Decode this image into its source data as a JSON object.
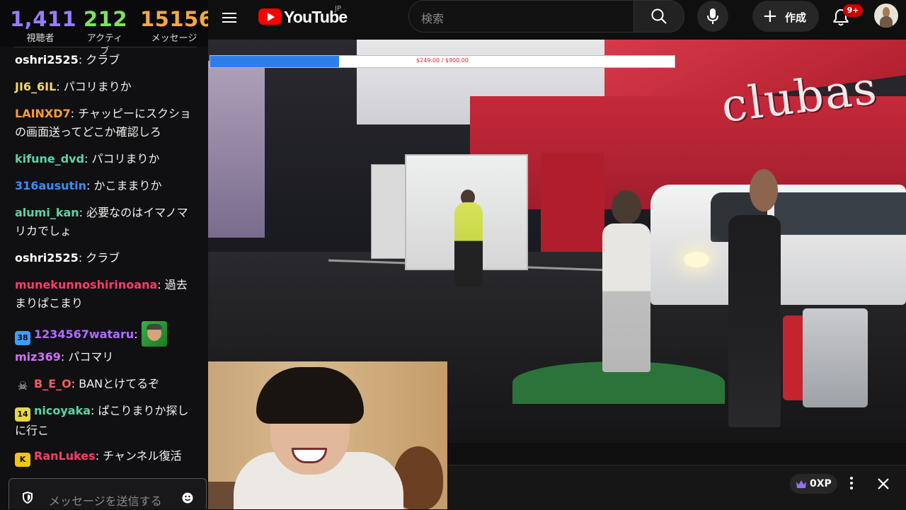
{
  "stats": [
    {
      "value": "1,411",
      "label": "視聴者"
    },
    {
      "value": "212",
      "label": "アクティブ"
    },
    {
      "value": "15156",
      "label": "メッセージ"
    }
  ],
  "chat": {
    "messages": [
      {
        "user": "oshri2525",
        "text": ": クラブ",
        "color": "#ffffff"
      },
      {
        "user": "JI6_6IL",
        "text": ": パコリまりか",
        "color": "#f5d76e"
      },
      {
        "user": "LAINXD7",
        "text": ": チャッピーにスクショの画面送ってどこか確認しろ",
        "color": "#ff9b3b"
      },
      {
        "user": "kifune_dvd",
        "text": ": パコリまりか",
        "color": "#58d6a8"
      },
      {
        "user": "316ausutin",
        "text": ": かこままりか",
        "color": "#3a8dff"
      },
      {
        "user": "alumi_kan",
        "text": ": 必要なのはイマノマリカでしょ",
        "color": "#58d6a8"
      },
      {
        "user": "oshri2525",
        "text": ": クラブ",
        "color": "#ffffff"
      },
      {
        "user": "munekunnoshirinoana",
        "text": ": 過去まりぱこまり",
        "color": "#ff3b6b"
      },
      {
        "user": "1234567wataru",
        "text": ":",
        "color": "#b06cff",
        "badge": "38",
        "badge_color": "#3aa0ff",
        "emote": "face-emote"
      },
      {
        "user": "miz369",
        "text": ": パコマリ",
        "color": "#d66bff"
      },
      {
        "user": "B_E_O",
        "text": ": BANとけてるぞ",
        "color": "#ff5a5a",
        "badge_icon": "skull-icon"
      },
      {
        "user": "nicoyaka",
        "text": ": ぱこりまりか探しに行こ",
        "color": "#58d6a8",
        "badge": "14",
        "badge_color": "#e6d64a"
      },
      {
        "user": "RanLukes",
        "text": ": チャンネル復活",
        "color": "#ff3b6b",
        "badge_icon": "k-icon"
      }
    ],
    "input_placeholder": "メッセージを送信する"
  },
  "header": {
    "logo_text": "YouTube",
    "region": "JP",
    "search_placeholder": "検索",
    "create_label": "作成",
    "notification_count": "9+"
  },
  "video": {
    "goal_text": "$249.00 / $900.00",
    "goal_progress": 0.277,
    "sign_text": "clubas"
  },
  "bottom": {
    "xp_label": "0XP"
  },
  "colors": {
    "accent": "#ff0000",
    "goal_fill": "#2f7fe8"
  }
}
